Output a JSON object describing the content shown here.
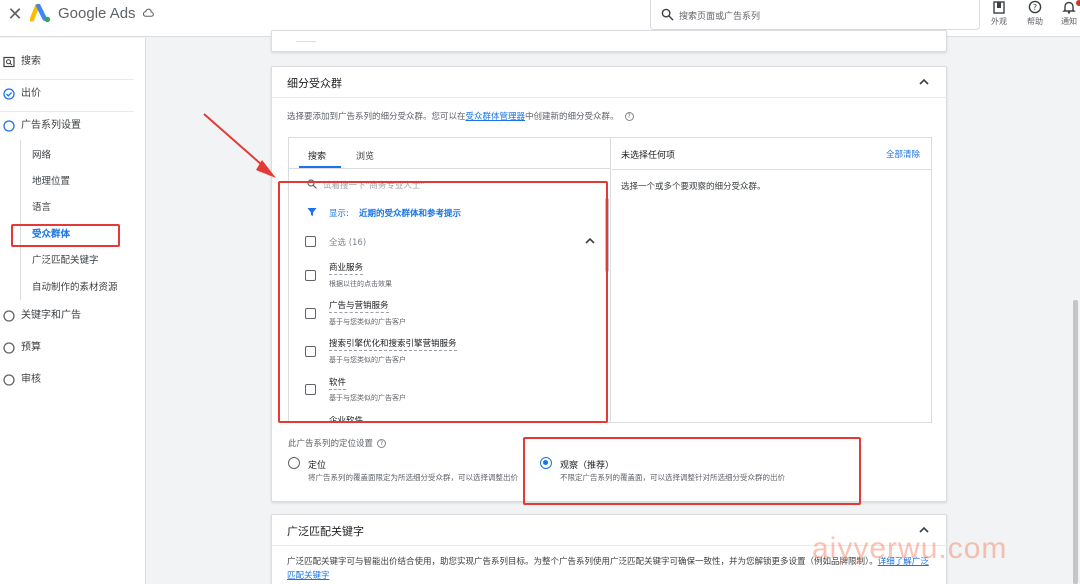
{
  "topbar": {
    "close_icon": "close-icon",
    "brand": "Google Ads",
    "search_placeholder": "搜索页面或广告系列",
    "actions": [
      {
        "icon": "appearance-icon",
        "label": "外观"
      },
      {
        "icon": "help-icon",
        "label": "帮助"
      },
      {
        "icon": "bell-icon",
        "label": "通知"
      }
    ]
  },
  "sidebar": {
    "items": [
      {
        "icon": "search-icon",
        "label": "搜索"
      },
      {
        "icon": "check-circle-icon",
        "label": "出价"
      },
      {
        "icon": "circle-icon",
        "label": "广告系列设置"
      },
      {
        "icon": "circle-icon",
        "label": "关键字和广告"
      },
      {
        "icon": "circle-icon",
        "label": "预算"
      },
      {
        "icon": "circle-icon",
        "label": "审核"
      }
    ],
    "subitems": [
      "网络",
      "地理位置",
      "语言",
      "受众群体",
      "广泛匹配关键字",
      "自动制作的素材资源"
    ],
    "active_subitem": "受众群体"
  },
  "segments": {
    "title": "细分受众群",
    "desc_before": "选择要添加到广告系列的细分受众群。您可以在",
    "desc_link": "受众群体管理器",
    "desc_after": "中创建新的细分受众群。",
    "tabs": [
      "搜索",
      "浏览"
    ],
    "search_placeholder": "试着搜一下\"商务专业人士\"",
    "filter_label": "显示:",
    "filter_value": "近期的受众群体和参考提示",
    "select_all": "全选 (16)",
    "items": [
      {
        "name": "商业服务",
        "sub": "根据以往的点击效果"
      },
      {
        "name": "广告与营销服务",
        "sub": "基于与您类似的广告客户"
      },
      {
        "name": "搜索引擎优化和搜索引擎营销服务",
        "sub": "基于与您类似的广告客户"
      },
      {
        "name": "软件",
        "sub": "基于与您类似的广告客户"
      }
    ],
    "clipped_item": "企业软件",
    "right_title": "未选择任何项",
    "clear_all": "全部清除",
    "right_hint": "选择一个或多个要观察的细分受众群。",
    "targeting_label": "此广告系列的定位设置",
    "options": [
      {
        "title": "定位",
        "desc": "将广告系列的覆盖面限定为所选细分受众群，可以选择调整出价",
        "checked": false
      },
      {
        "title": "观察（推荐）",
        "desc": "不限定广告系列的覆盖面，可以选择调整针对所选细分受众群的出价",
        "checked": true
      }
    ]
  },
  "broad": {
    "title": "广泛匹配关键字",
    "desc": "广泛匹配关键字可与智能出价结合使用，助您实现广告系列目标。为整个广告系列使用广泛匹配关键字可确保一致性，并为您解锁更多设置（例如品牌限制）。",
    "link": "详细了解广泛匹配关键字"
  },
  "watermark": "aiyyerwu.com",
  "colors": {
    "accent": "#1a73e8",
    "annotation_red": "#e53935"
  }
}
